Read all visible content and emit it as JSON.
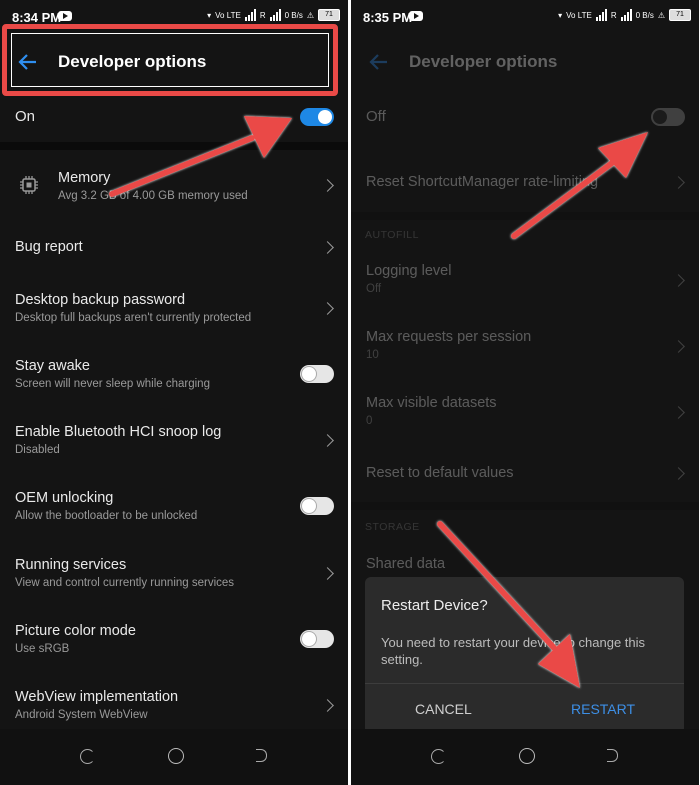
{
  "left": {
    "status_time": "8:34 PM",
    "battery": "71",
    "title": "Developer options",
    "master_label": "On",
    "master_state": "on",
    "items": [
      {
        "title": "Memory",
        "subtitle": "Avg 3.2 GB of 4.00 GB memory used",
        "control": "chevron",
        "icon": "chip-icon"
      },
      {
        "title": "Bug report",
        "subtitle": "",
        "control": "chevron"
      },
      {
        "title": "Desktop backup password",
        "subtitle": "Desktop full backups aren't currently protected",
        "control": "chevron"
      },
      {
        "title": "Stay awake",
        "subtitle": "Screen will never sleep while charging",
        "control": "toggle-off"
      },
      {
        "title": "Enable Bluetooth HCI snoop log",
        "subtitle": "Disabled",
        "control": "chevron"
      },
      {
        "title": "OEM unlocking",
        "subtitle": "Allow the bootloader to be unlocked",
        "control": "toggle-off"
      },
      {
        "title": "Running services",
        "subtitle": "View and control currently running services",
        "control": "chevron"
      },
      {
        "title": "Picture color mode",
        "subtitle": "Use sRGB",
        "control": "toggle-off"
      },
      {
        "title": "WebView implementation",
        "subtitle": "Android System WebView",
        "control": "chevron"
      }
    ]
  },
  "right": {
    "status_time": "8:35 PM",
    "battery": "71",
    "title": "Developer options",
    "master_label": "Off",
    "master_state": "off",
    "reset_shortcut": "Reset ShortcutManager rate-limiting",
    "autofill_header": "AUTOFILL",
    "autofill_items": [
      {
        "title": "Logging level",
        "subtitle": "Off"
      },
      {
        "title": "Max requests per session",
        "subtitle": "10"
      },
      {
        "title": "Max visible datasets",
        "subtitle": "0"
      },
      {
        "title": "Reset to default values",
        "subtitle": ""
      }
    ],
    "storage_header": "STORAGE",
    "shared_data": "Shared data"
  },
  "dialog": {
    "title": "Restart Device?",
    "message": "You need to restart your device to change this setting.",
    "cancel": "CANCEL",
    "restart": "RESTART"
  },
  "status_icons": {
    "volte": "Vo LTE",
    "data_rate": "0 B/s",
    "r_label": "R"
  },
  "colors": {
    "accent": "#1e88e5",
    "annotation": "#ea4a47",
    "background": "#141414"
  }
}
